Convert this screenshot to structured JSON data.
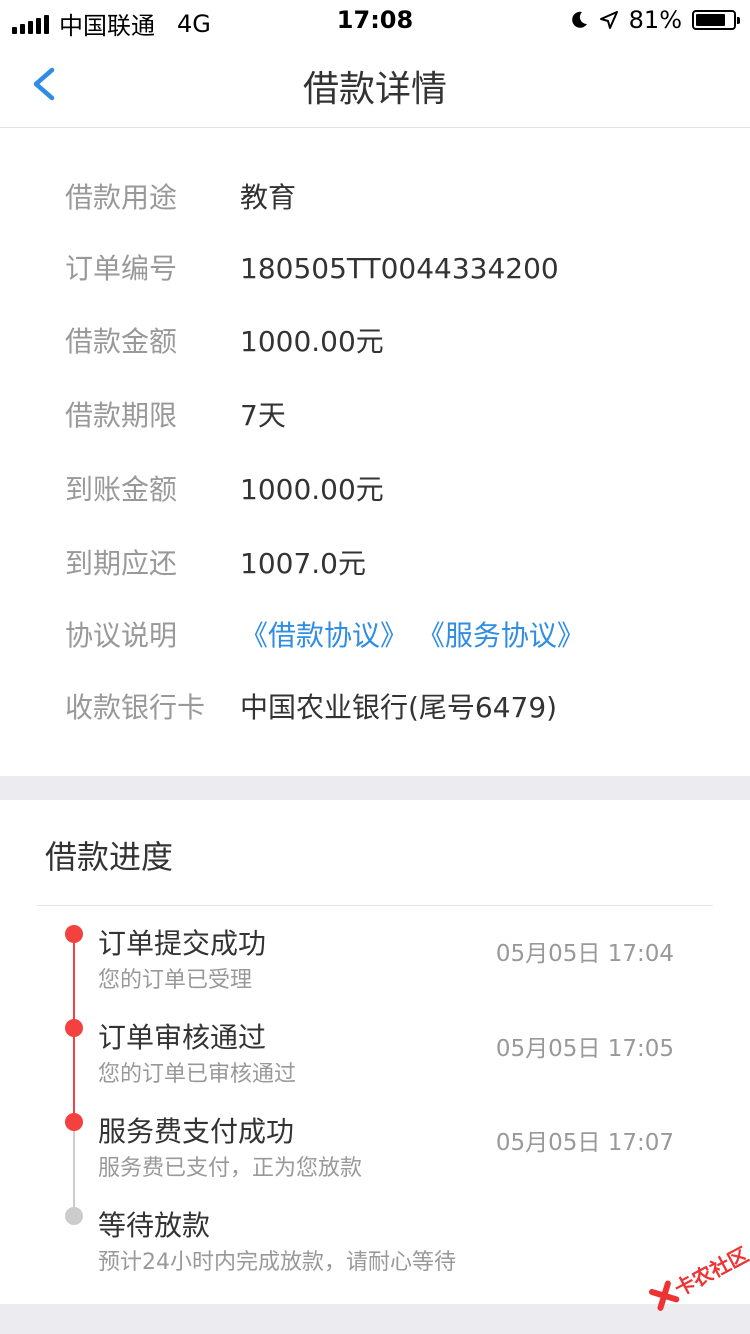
{
  "status_bar": {
    "carrier": "中国联通",
    "network": "4G",
    "time": "17:08",
    "battery": "81%",
    "battery_level": 0.81
  },
  "nav": {
    "title": "借款详情",
    "back_icon": "chevron-left-icon"
  },
  "details": [
    {
      "label": "借款用途",
      "value": "教育"
    },
    {
      "label": "订单编号",
      "value": "180505TT0044334200"
    },
    {
      "label": "借款金额",
      "value": "1000.00元"
    },
    {
      "label": "借款期限",
      "value": "7天"
    },
    {
      "label": "到账金额",
      "value": "1000.00元"
    },
    {
      "label": "到期应还",
      "value": "1007.0元"
    },
    {
      "label": "协议说明",
      "links": [
        "《借款协议》",
        "《服务协议》"
      ]
    },
    {
      "label": "收款银行卡",
      "value": "中国农业银行(尾号6479)"
    }
  ],
  "progress": {
    "title": "借款进度",
    "steps": [
      {
        "title": "订单提交成功",
        "desc": "您的订单已受理",
        "time": "05月05日 17:04",
        "done": true
      },
      {
        "title": "订单审核通过",
        "desc": "您的订单已审核通过",
        "time": "05月05日 17:05",
        "done": true
      },
      {
        "title": "服务费支付成功",
        "desc": "服务费已支付，正为您放款",
        "time": "05月05日 17:07",
        "done": true
      },
      {
        "title": "等待放款",
        "desc": "预计24小时内完成放款，请耐心等待",
        "done": false
      }
    ]
  },
  "watermark": {
    "text": "卡农社区"
  },
  "colors": {
    "accent": "#2f8de4",
    "done": "#f2413f",
    "pending": "#cccccc",
    "link": "#2f8de4"
  }
}
